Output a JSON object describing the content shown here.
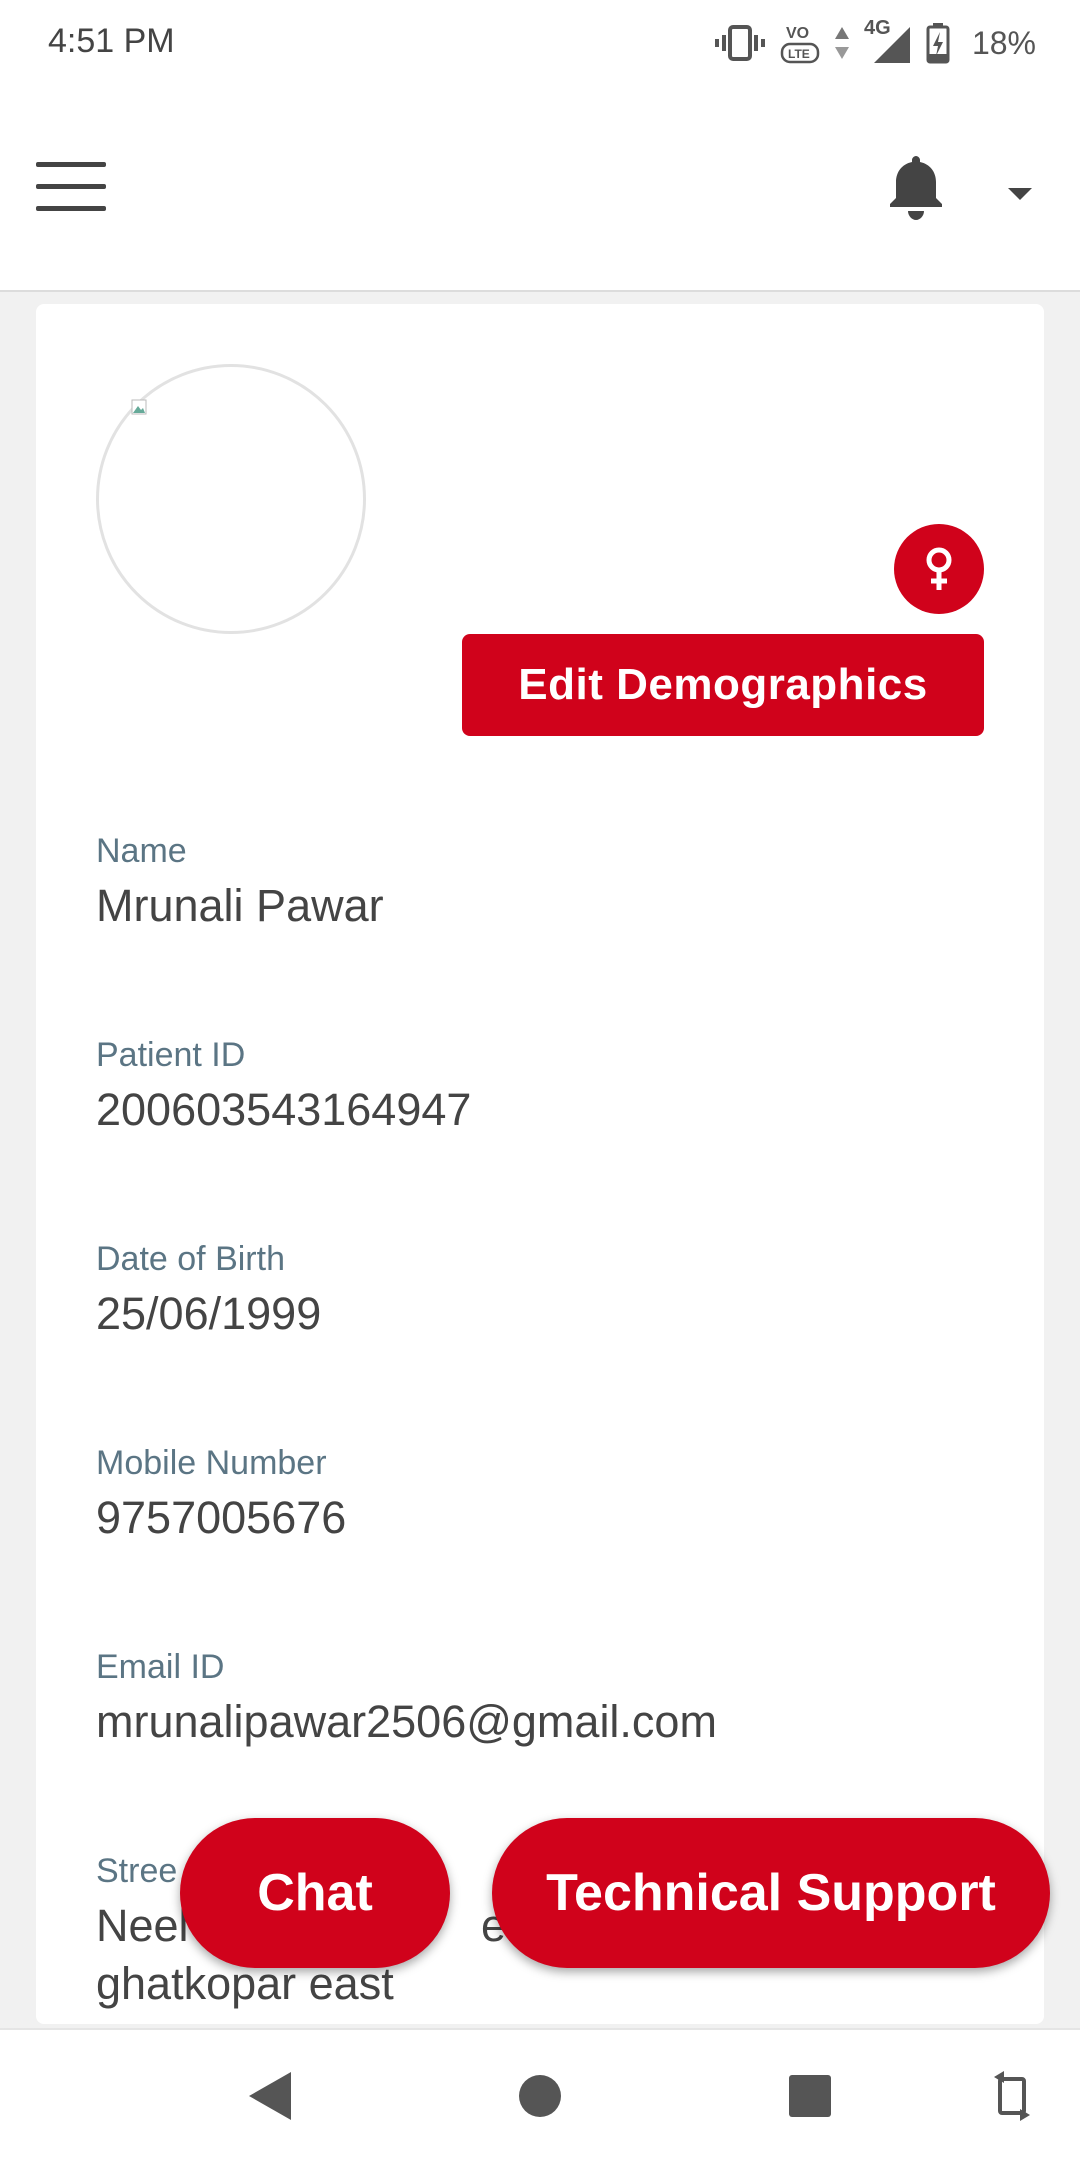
{
  "status_bar": {
    "time": "4:51 PM",
    "network": "4G",
    "battery": "18%",
    "icons": [
      "vibrate-icon",
      "volte-icon",
      "data-arrows-icon",
      "signal-icon",
      "battery-charging-icon"
    ]
  },
  "app_bar": {
    "menu_icon": "hamburger-menu-icon",
    "notification_icon": "bell-icon",
    "dropdown_icon": "caret-down-icon"
  },
  "profile": {
    "gender_icon": "female-icon",
    "edit_button": "Edit Demographics",
    "fields": [
      {
        "label": "Name",
        "value": "Mrunali Pawar"
      },
      {
        "label": "Patient ID",
        "value": "200603543164947"
      },
      {
        "label": "Date of Birth",
        "value": "25/06/1999"
      },
      {
        "label": "Mobile Number",
        "value": "9757005676"
      },
      {
        "label": "Email ID",
        "value": "mrunalipawar2506@gmail.com"
      }
    ],
    "street": {
      "label_visible": "Stree",
      "value_line1_visible": "Neel",
      "value_line1_visible_b": "en",
      "value_line2": "ghatkopar east"
    }
  },
  "fabs": {
    "chat": "Chat",
    "support": "Technical Support"
  },
  "colors": {
    "accent": "#d0021b",
    "label": "#5b7584",
    "text": "#444444"
  }
}
